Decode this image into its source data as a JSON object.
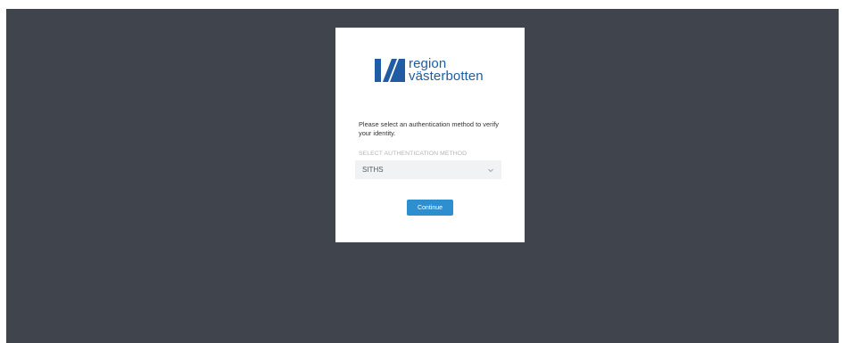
{
  "logo": {
    "line1": "region",
    "line2": "västerbotten",
    "color": "#1f5ca3"
  },
  "prompt": "Please select an authentication method to verify your identity.",
  "method": {
    "label": "SELECT AUTHENTICATION METHOD",
    "selected": "SITHS"
  },
  "continue_label": "Continue",
  "colors": {
    "backdrop": "#40454d",
    "button": "#2d8ed0"
  }
}
